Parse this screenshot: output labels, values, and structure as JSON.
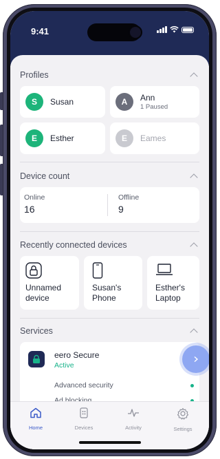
{
  "status_bar": {
    "time": "9:41"
  },
  "profiles": {
    "title": "Profiles",
    "items": [
      {
        "initial": "S",
        "name": "Susan",
        "sub": "",
        "color": "#1db47a"
      },
      {
        "initial": "A",
        "name": "Ann",
        "sub": "1 Paused",
        "color": "#6b6e7b"
      },
      {
        "initial": "E",
        "name": "Esther",
        "sub": "",
        "color": "#1db47a"
      },
      {
        "initial": "E",
        "name": "Eames",
        "sub": "",
        "color": "#c9cad0"
      }
    ]
  },
  "device_count": {
    "title": "Device count",
    "online_label": "Online",
    "online_value": "16",
    "offline_label": "Offline",
    "offline_value": "9"
  },
  "recent_devices": {
    "title": "Recently connected devices",
    "items": [
      {
        "line1": "Unnamed",
        "line2": "device",
        "icon": "lock-icon"
      },
      {
        "line1": "Susan's",
        "line2": "Phone",
        "icon": "phone-icon"
      },
      {
        "line1": "Esther's",
        "line2": "Laptop",
        "icon": "laptop-icon"
      }
    ]
  },
  "services": {
    "title": "Services",
    "product": "eero Secure",
    "status": "Active",
    "features": [
      "Advanced security",
      "Ad blocking"
    ]
  },
  "tabs": {
    "home": "Home",
    "devices": "Devices",
    "activity": "Activity",
    "settings": "Settings"
  },
  "colors": {
    "accent": "#3a5ac8",
    "active_green": "#18b38a",
    "header_navy": "#1f2a56",
    "fab_blue": "#8ea7f2"
  }
}
